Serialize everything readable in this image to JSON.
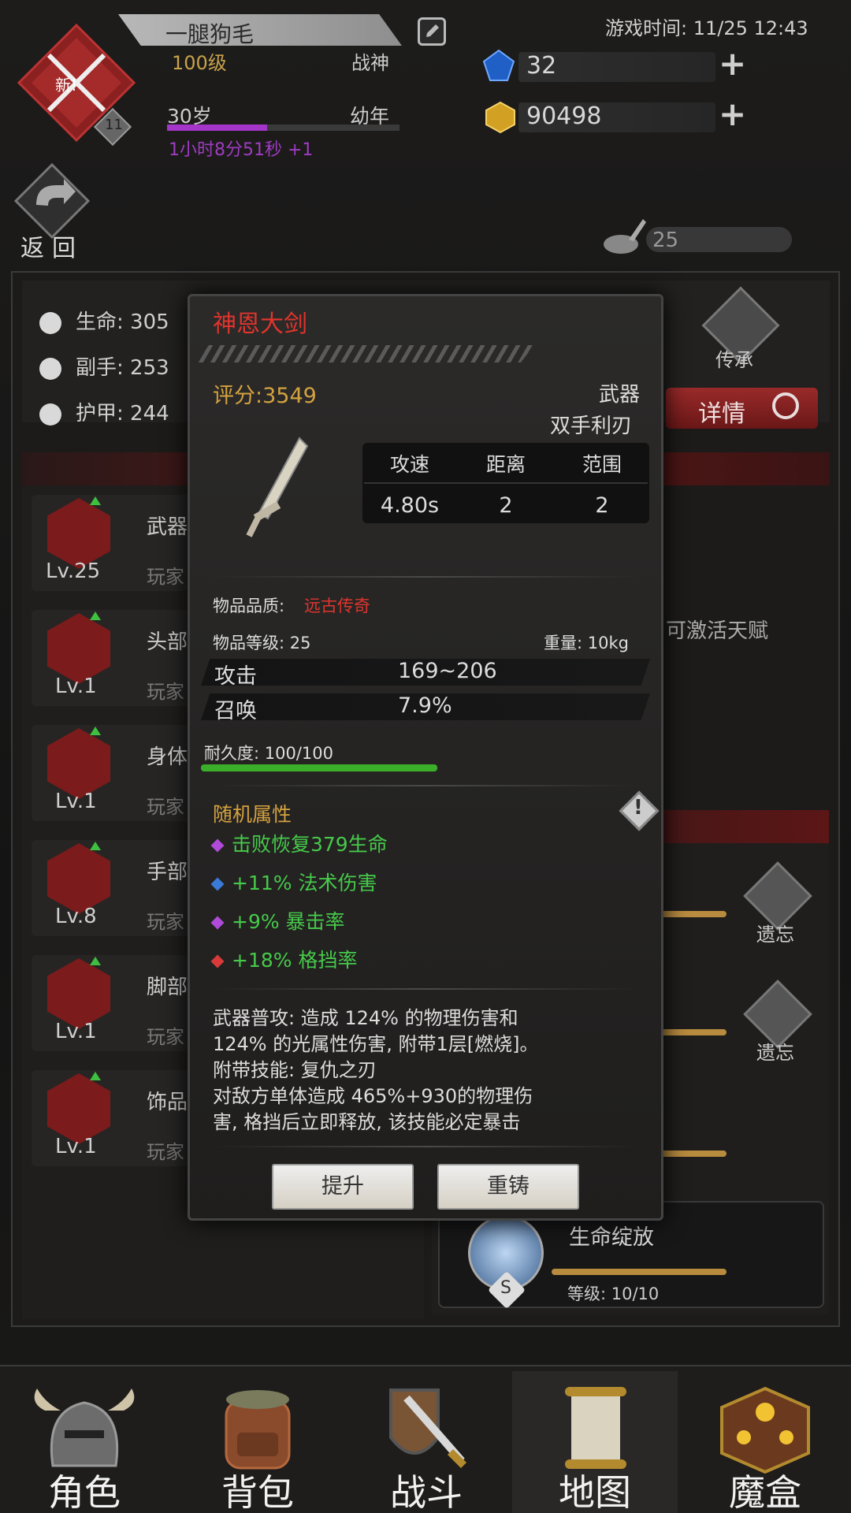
{
  "player": {
    "name": "一腿狗毛",
    "level": "100级",
    "rank": "战神",
    "age": "30岁",
    "stage": "幼年",
    "age_timer": "1小时8分51秒 +1",
    "badge_new": "新!",
    "badge_count": "11",
    "age_progress": 0.43
  },
  "game_time": "游戏时间: 11/25 12:43",
  "currency": {
    "gems": "32",
    "gold": "90498",
    "stamina": "25"
  },
  "back_label": "返回",
  "stats": [
    {
      "label": "生命: 305"
    },
    {
      "label": "副手: 253"
    },
    {
      "label": "护甲: 244"
    }
  ],
  "inherit_label": "传承",
  "details_label": "详情",
  "talent_hint": "可激活天赋",
  "equipment": [
    {
      "title": "武器",
      "sub": "玩家",
      "level": "Lv.25"
    },
    {
      "title": "头部",
      "sub": "玩家",
      "level": "Lv.1"
    },
    {
      "title": "身体",
      "sub": "玩家",
      "level": "Lv.1"
    },
    {
      "title": "手部",
      "sub": "玩家",
      "level": "Lv.8"
    },
    {
      "title": "脚部",
      "sub": "玩家",
      "level": "Lv.1"
    },
    {
      "title": "饰品",
      "sub": "玩家",
      "level": "Lv.1"
    }
  ],
  "forget_labels": [
    "遗忘",
    "遗忘"
  ],
  "skill_card": {
    "name": "生命绽放",
    "level": "等级: 10/10",
    "grade": "S"
  },
  "modal": {
    "title": "神恩大剑",
    "score": "评分:3549",
    "type": "武器",
    "subtype": "双手利刃",
    "table_headers": [
      "攻速",
      "距离",
      "范围"
    ],
    "table_values": [
      "4.80s",
      "2",
      "2"
    ],
    "quality_label": "物品品质:",
    "quality_value": "远古传奇",
    "item_level": "物品等级: 25",
    "weight": "重量: 10kg",
    "attrs": [
      {
        "name": "攻击",
        "value": "169~206"
      },
      {
        "name": "召唤",
        "value": "7.9%"
      }
    ],
    "durability_label": "耐久度: 100/100",
    "durability": 1.0,
    "random_title": "随机属性",
    "effects": [
      {
        "text": "击败恢复379生命",
        "gem": "#b04ad8"
      },
      {
        "text": "+11% 法术伤害",
        "gem": "#3a7ad8"
      },
      {
        "text": "+9% 暴击率",
        "gem": "#b04ad8"
      },
      {
        "text": "+18% 格挡率",
        "gem": "#d83a3a"
      }
    ],
    "desc_lines": [
      "武器普攻: 造成 124% 的物理伤害和",
      "124% 的光属性伤害, 附带1层[燃烧]。",
      "附带技能: 复仇之刃",
      "对敌方单体造成 465%+930的物理伤",
      "害, 格挡后立即释放, 该技能必定暴击"
    ],
    "btn_upgrade": "提升",
    "btn_reforge": "重铸"
  },
  "nav": [
    {
      "label": "角色",
      "icon": "helmet-icon"
    },
    {
      "label": "背包",
      "icon": "backpack-icon"
    },
    {
      "label": "战斗",
      "icon": "sword-shield-icon"
    },
    {
      "label": "地图",
      "icon": "scroll-map-icon"
    },
    {
      "label": "魔盒",
      "icon": "magic-box-icon"
    }
  ]
}
